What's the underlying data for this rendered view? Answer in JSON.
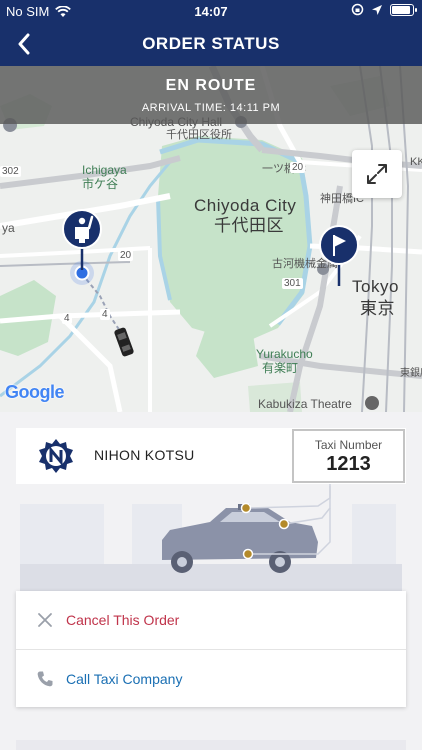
{
  "status_bar": {
    "carrier": "No SIM",
    "time": "14:07"
  },
  "nav": {
    "title": "ORDER STATUS"
  },
  "order": {
    "status": "EN ROUTE",
    "arrival_text": "ARRIVAL TIME: 14:11 PM"
  },
  "map": {
    "labels": {
      "chiyoda_city_hall": "Chiyoda City Hall",
      "chiyoda_ward_office": "千代田区役所",
      "ichigaya_en": "Ichigaya",
      "ichigaya_jp": "市ケ谷",
      "chiyoda_city_en": "Chiyoda City",
      "chiyoda_city_jp": "千代田区",
      "tokyo_en": "Tokyo",
      "tokyo_jp": "東京",
      "yurakucho_en": "Yurakucho",
      "yurakucho_jp": "有楽町",
      "kabukiza": "Kabukiza Theatre",
      "furukawa": "古河機械金属",
      "hitotsubashi": "一ツ橋IC",
      "kandabashi": "神田橋IC",
      "kk": "KK",
      "route_20a": "20",
      "route_20b": "20",
      "route_4a": "4",
      "route_4b": "4",
      "route_301": "301",
      "route_302": "302",
      "kabuki_jp": "東銀座",
      "ya": "ya"
    },
    "attribution": "Google"
  },
  "taxi": {
    "company": "NIHON KOTSU",
    "number_label": "Taxi Number",
    "number": "1213"
  },
  "actions": {
    "cancel": "Cancel This Order",
    "call": "Call Taxi Company"
  },
  "colors": {
    "nav_bg": "#18306b",
    "cancel": "#c0344b",
    "call": "#1a6fb3",
    "marker": "#18306b",
    "accent_dot": "#b48a2a"
  }
}
